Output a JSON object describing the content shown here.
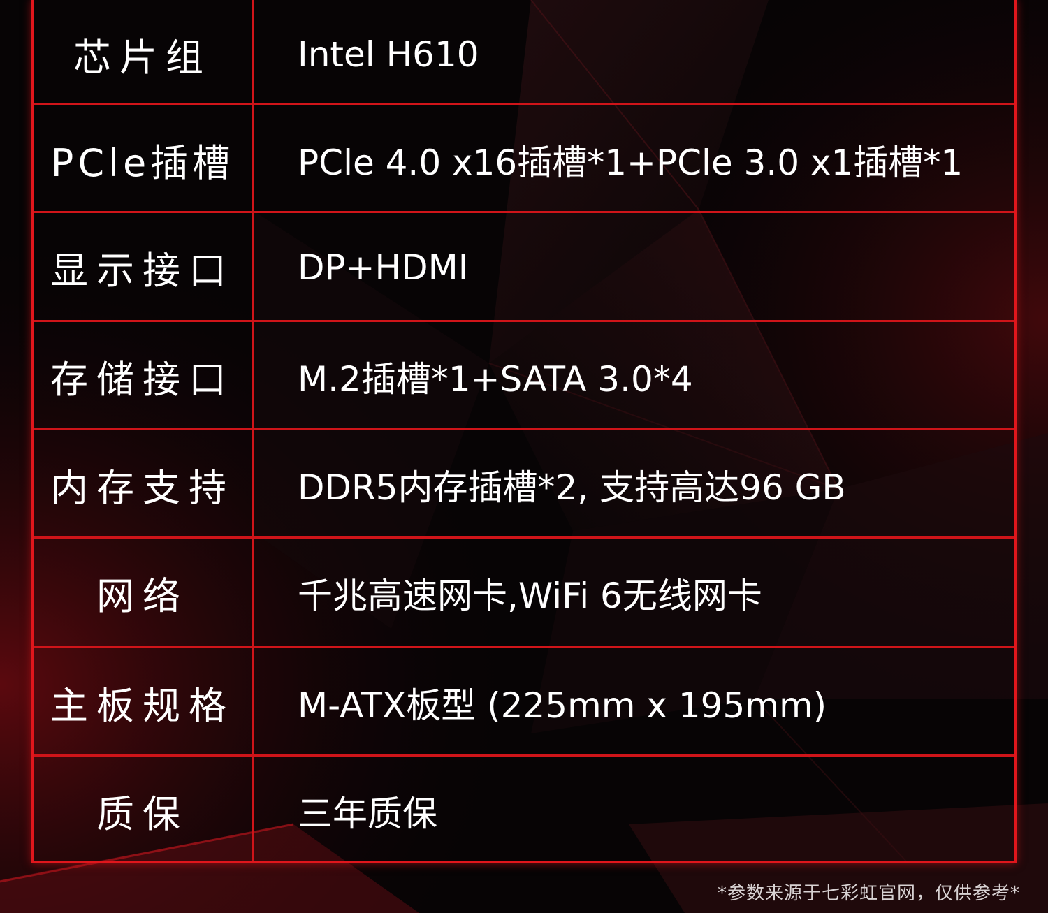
{
  "specs": [
    {
      "label": "芯片组",
      "value": "Intel H610"
    },
    {
      "label": "PCle插槽",
      "value": "PCle 4.0 x16插槽*1+PCle 3.0 x1插槽*1"
    },
    {
      "label": "显示接口",
      "value": "DP+HDMI"
    },
    {
      "label": "存储接口",
      "value": "M.2插槽*1+SATA 3.0*4"
    },
    {
      "label": "内存支持",
      "value": "DDR5内存插槽*2, 支持高达96 GB"
    },
    {
      "label": "网络",
      "value": "千兆高速网卡,WiFi 6无线网卡"
    },
    {
      "label": "主板规格",
      "value": "M-ATX板型 (225mm x 195mm)"
    },
    {
      "label": "质保",
      "value": "三年质保"
    }
  ],
  "footnote": "*参数来源于七彩虹官网，仅供参考*",
  "colors": {
    "accent": "#e0161c",
    "background": "#070405",
    "text": "#ffffff"
  }
}
